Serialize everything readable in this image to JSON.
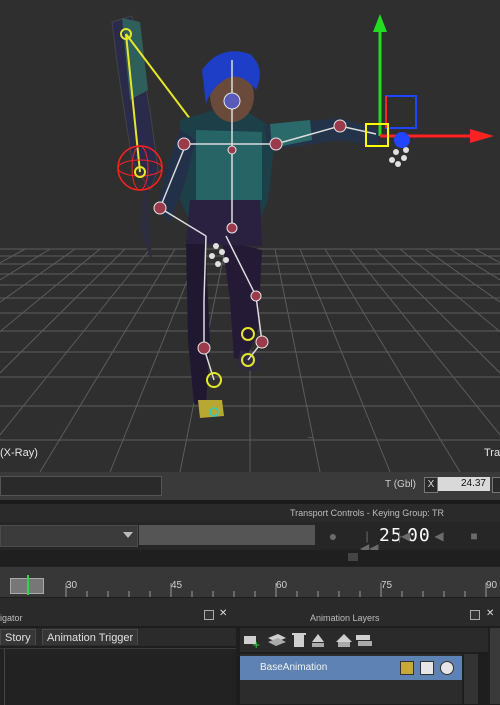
{
  "viewport": {
    "mode_label": "(X-Ray)",
    "right_label": "Tra",
    "colors": {
      "background": "#2f2f2f",
      "grid": "#5a5a5a",
      "axis_y": "#22dd22",
      "axis_x": "#ff2222",
      "axis_z": "#2244ff",
      "selection": "#ffff00"
    }
  },
  "status": {
    "coord_label": "T (Gbl)",
    "x_label": "X",
    "x_value": "24.37"
  },
  "transport": {
    "title": "Transport Controls  -  Keying Group: TR",
    "frame": "25",
    "subframe": "00",
    "buttons": [
      "record-icon",
      "go-start-icon",
      "prev-key-icon",
      "play-back-icon",
      "stop-icon"
    ]
  },
  "timeline": {
    "labels": [
      "30",
      "45",
      "60",
      "75",
      "90"
    ],
    "current_frame": 25
  },
  "navigator": {
    "title": "igator",
    "tabs": [
      "Story",
      "Animation Trigger"
    ]
  },
  "layers": {
    "title": "Animation Layers",
    "layer_name": "BaseAnimation",
    "tools": [
      "add-layer-icon",
      "layers-icon",
      "delete-icon",
      "merge-icon",
      "layer-up-icon",
      "layer-down-icon"
    ]
  }
}
